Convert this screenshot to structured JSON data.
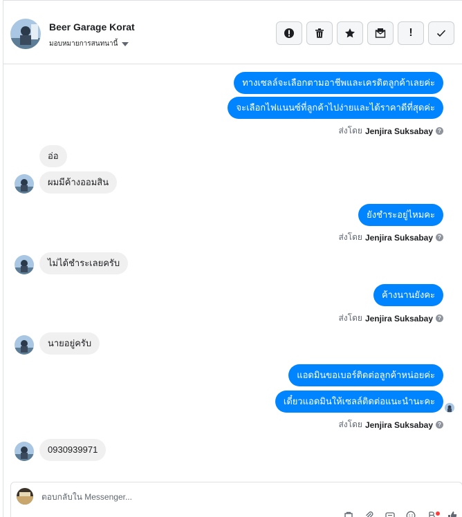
{
  "header": {
    "name": "Beer Garage Korat",
    "status": "มอบหมายการสนทนานี้"
  },
  "actions": [
    {
      "name": "report-spam-button",
      "icon": "alert-circle-icon"
    },
    {
      "name": "delete-button",
      "icon": "trash-icon"
    },
    {
      "name": "star-button",
      "icon": "star-icon"
    },
    {
      "name": "mark-unread-button",
      "icon": "envelope-icon"
    },
    {
      "name": "follow-up-button",
      "icon": "exclamation-icon",
      "label": "!"
    },
    {
      "name": "mark-done-button",
      "icon": "check-icon"
    }
  ],
  "messages": {
    "out1": "ทางเซลล์จะเลือกตามอาชีพและเครดิตลูกค้าเลยค่ะ",
    "out2": "จะเลือกไฟแนนซ์ที่ลูกค้าไปง่ายและได้ราคาดีที่สุดค่ะ",
    "in1": "อ่อ",
    "in2": "ผมมีค้างออมสิน",
    "out3": "ยังชำระอยู่ไหมคะ",
    "in3": "ไม่ได้ชำระเลยครับ",
    "out4": "ค้างนานยังคะ",
    "in4": "นายอยู่ครับ",
    "out5": "แอดมินขอเบอร์ติดต่อลูกค้าหน่อยค่ะ",
    "out6": "เดี๋ยวแอดมินให้เซลล์ติดต่อแนะนำนะคะ",
    "in5": "0930939971"
  },
  "sent_by": {
    "prefix": "ส่งโดย",
    "agent": "Jenjira Suksabay"
  },
  "composer": {
    "placeholder": "ตอบกลับใน Messenger..."
  },
  "colors": {
    "outgoing_bubble": "#0084ff",
    "incoming_bubble": "#f1f0f0",
    "notification_dot": "#fa3e3e"
  }
}
